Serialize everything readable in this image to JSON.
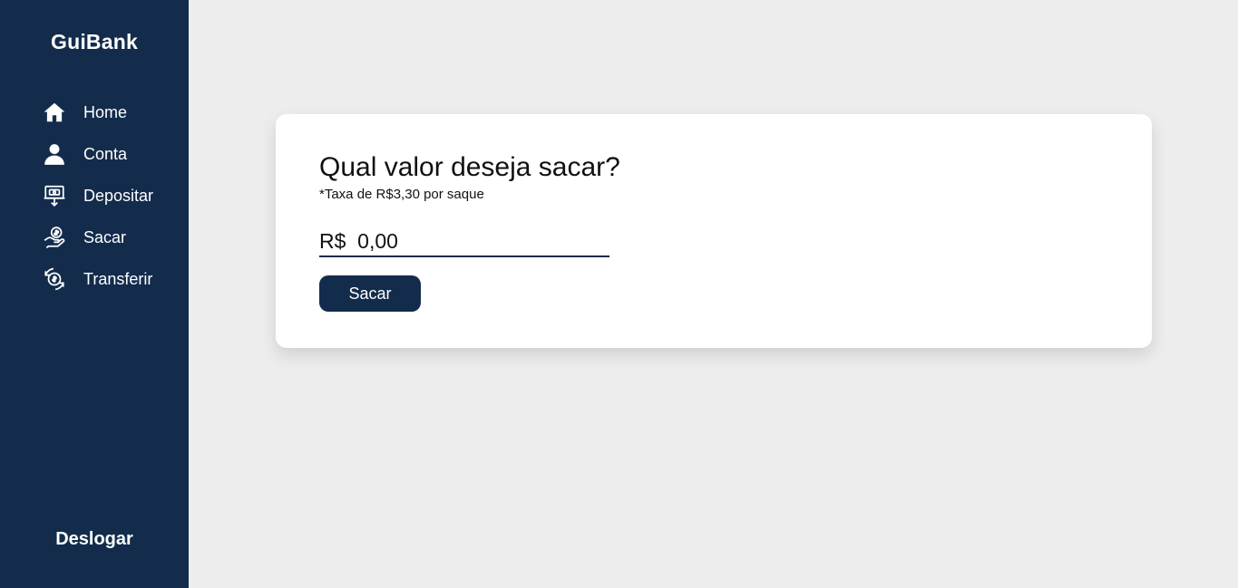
{
  "sidebar": {
    "brand": "GuiBank",
    "items": [
      {
        "label": "Home",
        "icon": "home-icon"
      },
      {
        "label": "Conta",
        "icon": "user-icon"
      },
      {
        "label": "Depositar",
        "icon": "deposit-icon"
      },
      {
        "label": "Sacar",
        "icon": "withdraw-icon"
      },
      {
        "label": "Transferir",
        "icon": "transfer-icon"
      }
    ],
    "logout_label": "Deslogar"
  },
  "card": {
    "title": "Qual valor deseja sacar?",
    "fee_note": "*Taxa de R$3,30 por saque",
    "amount_value": "R$  0,00",
    "submit_label": "Sacar"
  },
  "colors": {
    "sidebar_bg": "#132c4c",
    "page_bg": "#ededed",
    "card_bg": "#ffffff",
    "button_bg": "#132c4c"
  }
}
